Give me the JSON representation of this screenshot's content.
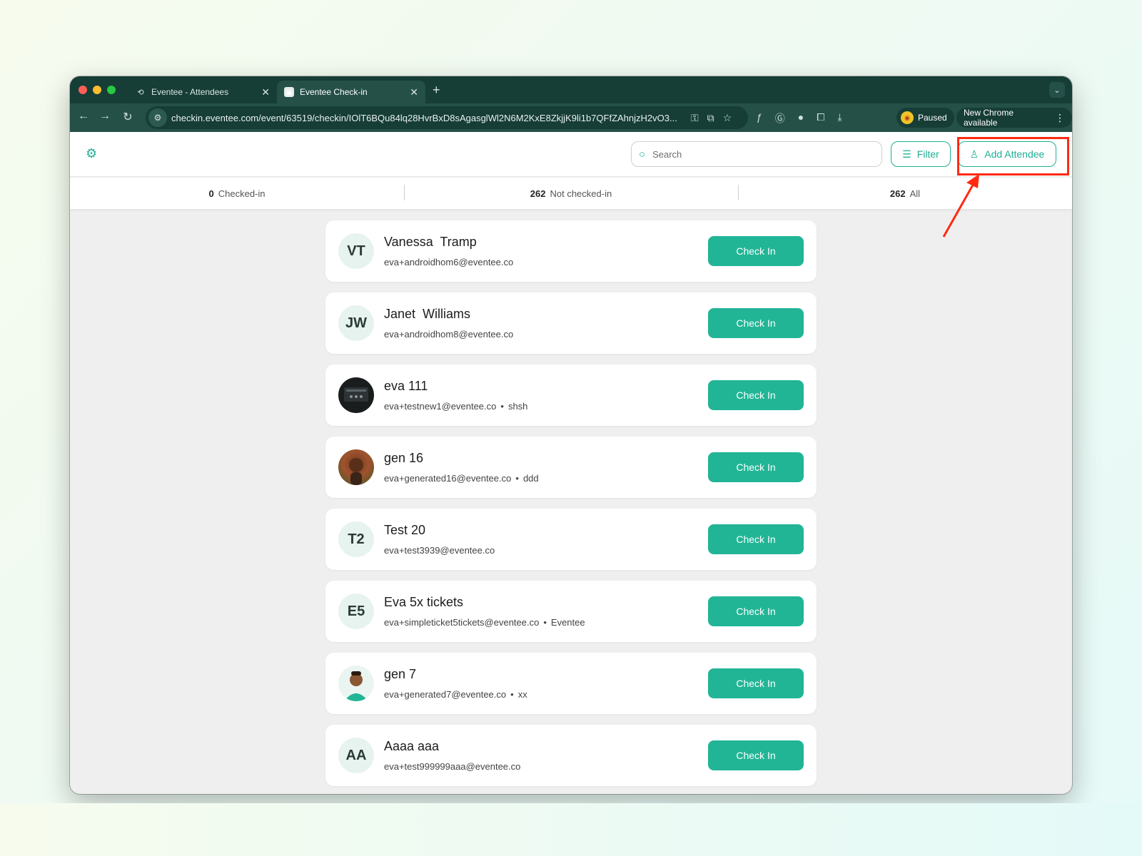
{
  "browser": {
    "tabs": [
      {
        "title": "Eventee - Attendees",
        "active": false
      },
      {
        "title": "Eventee Check-in",
        "active": true
      }
    ],
    "url": "checkin.eventee.com/event/63519/checkin/IOlT6BQu84lq28HvrBxD8sAgasglWl2N6M2KxE8ZkjjK9li1b7QFfZAhnjzH2vO3...",
    "profile_status": "Paused",
    "update_label": "New Chrome available",
    "icons": {
      "back": "arrow-left-icon",
      "forward": "arrow-right-icon",
      "reload": "reload-icon",
      "site_settings": "tune-icon",
      "password": "key-icon",
      "install": "install-icon",
      "bookmark": "star-icon",
      "extensions": "puzzle-icon",
      "downloads": "download-icon"
    }
  },
  "app": {
    "search_placeholder": "Search",
    "filter_label": "Filter",
    "add_attendee_label": "Add Attendee",
    "accent_color": "#21b596",
    "stats": [
      {
        "count": "0",
        "label": "Checked-in"
      },
      {
        "count": "262",
        "label": "Not checked-in"
      },
      {
        "count": "262",
        "label": "All"
      }
    ],
    "attendees": [
      {
        "initials": "VT",
        "name": "Vanessa  Tramp",
        "email": "eva+androidhom6@eventee.co",
        "extra": "",
        "avatar": "initials",
        "button": "Check In"
      },
      {
        "initials": "JW",
        "name": "Janet  Williams",
        "email": "eva+androidhom8@eventee.co",
        "extra": "",
        "avatar": "initials",
        "button": "Check In"
      },
      {
        "initials": "",
        "name": "eva 111",
        "email": "eva+testnew1@eventee.co",
        "extra": "shsh",
        "avatar": "photo",
        "button": "Check In"
      },
      {
        "initials": "",
        "name": "gen 16",
        "email": "eva+generated16@eventee.co",
        "extra": "ddd",
        "avatar": "photo",
        "button": "Check In"
      },
      {
        "initials": "T2",
        "name": "Test 20",
        "email": "eva+test3939@eventee.co",
        "extra": "",
        "avatar": "initials",
        "button": "Check In"
      },
      {
        "initials": "E5",
        "name": "Eva 5x tickets",
        "email": "eva+simpleticket5tickets@eventee.co",
        "extra": "Eventee",
        "avatar": "initials",
        "button": "Check In"
      },
      {
        "initials": "",
        "name": "gen 7",
        "email": "eva+generated7@eventee.co",
        "extra": "xx",
        "avatar": "photo",
        "button": "Check In"
      },
      {
        "initials": "AA",
        "name": "Aaaa aaa",
        "email": "eva+test999999aaa@eventee.co",
        "extra": "",
        "avatar": "initials",
        "button": "Check In"
      }
    ]
  },
  "annotation": {
    "color": "#ff2a12",
    "target": "add-attendee-button"
  }
}
